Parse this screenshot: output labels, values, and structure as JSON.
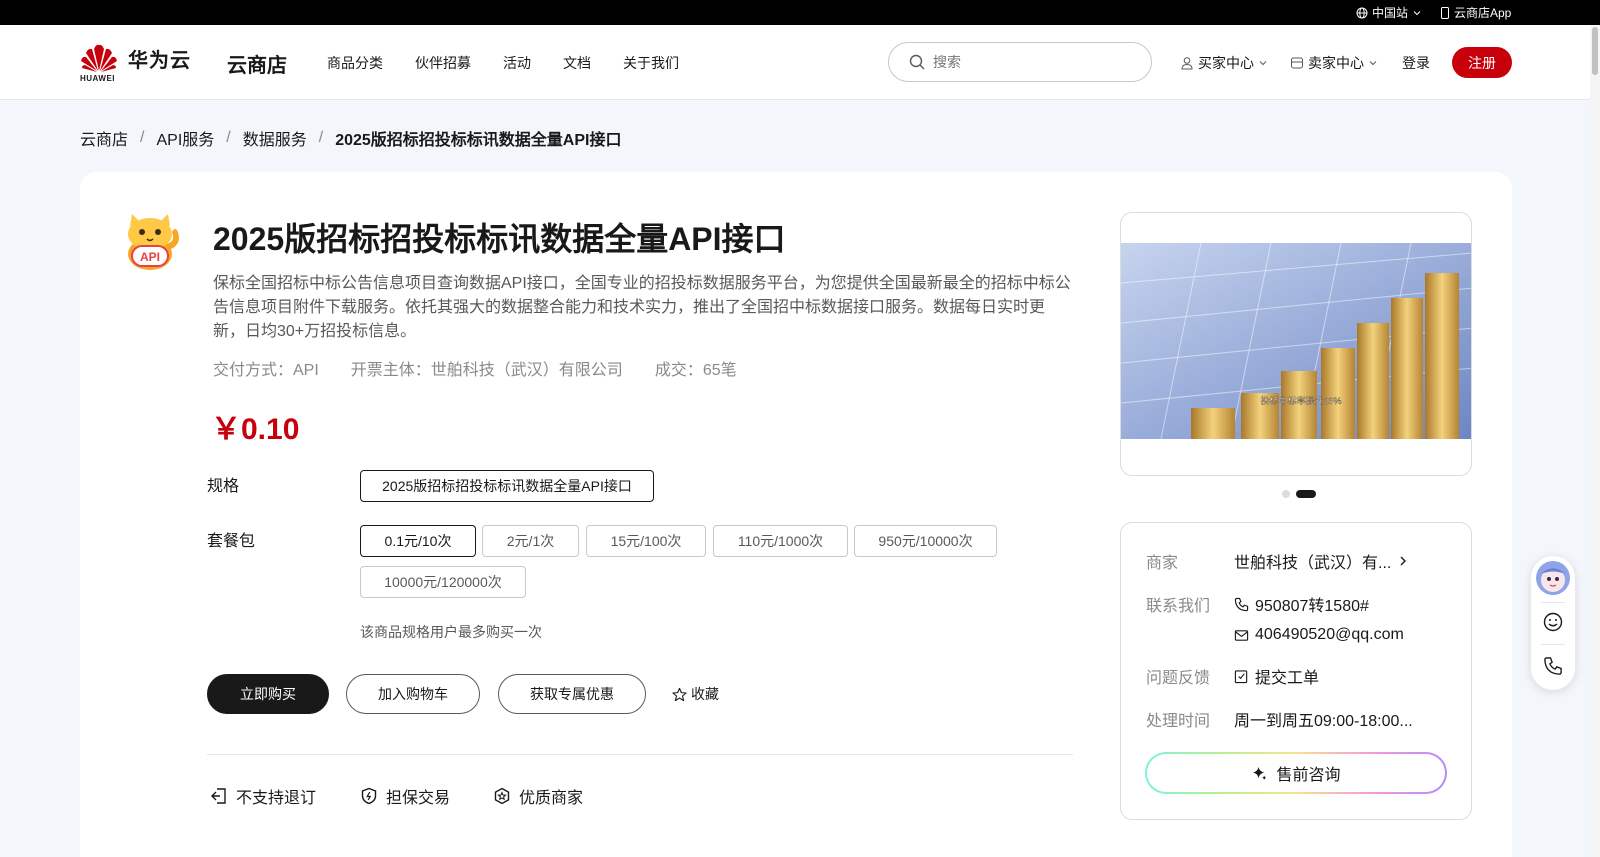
{
  "topbar": {
    "region": "中国站",
    "app": "云商店App"
  },
  "header": {
    "logo_text": "华为云",
    "logo_sub": "HUAWEI",
    "store": "云商店",
    "nav": [
      "商品分类",
      "伙伴招募",
      "活动",
      "文档",
      "关于我们"
    ],
    "search_placeholder": "搜索",
    "buyer_center": "买家中心",
    "seller_center": "卖家中心",
    "login": "登录",
    "signup": "注册"
  },
  "breadcrumb": [
    "云商店",
    "API服务",
    "数据服务",
    "2025版招标招投标标讯数据全量API接口"
  ],
  "product": {
    "icon_label": "API",
    "title": "2025版招标招投标标讯数据全量API接口",
    "description": "保标全国招标中标公告信息项目查询数据API接口，全国专业的招投标数据服务平台，为您提供全国最新最全的招标中标公告信息项目附件下载服务。依托其强大的数据整合能力和技术实力，推出了全国招中标数据接口服务。数据每日实时更新，日均30+万招投标信息。",
    "delivery": "交付方式：API",
    "invoice": "开票主体：世舶科技（武汉）有限公司",
    "deals": "成交：65笔",
    "price": "￥0.10",
    "spec_label": "规格",
    "spec_options": [
      "2025版招标招投标标讯数据全量API接口"
    ],
    "package_label": "套餐包",
    "package_options": [
      "0.1元/10次",
      "2元/1次",
      "15元/100次",
      "110元/1000次",
      "950元/10000次",
      "10000元/120000次"
    ],
    "selected_package": "0.1元/10次",
    "limit_note": "该商品规格用户最多购买一次",
    "buy_now": "立即购买",
    "add_cart": "加入购物车",
    "get_offer": "获取专属优惠",
    "favorite": "收藏",
    "guarantees": [
      "不支持退订",
      "担保交易",
      "优质商家"
    ],
    "slide_caption": "投标中标率提升25%"
  },
  "merchant": {
    "merchant_label": "商家",
    "merchant_name": "世舶科技（武汉）有...",
    "contact_label": "联系我们",
    "phone": "950807转1580#",
    "email": "406490520@qq.com",
    "feedback_label": "问题反馈",
    "feedback_action": "提交工单",
    "hours_label": "处理时间",
    "hours": "周一到周五09:00-18:00...",
    "consult": "售前咨询"
  },
  "colors": {
    "brand_red": "#c7000b",
    "text": "#191919",
    "muted": "#8a8a8a"
  }
}
